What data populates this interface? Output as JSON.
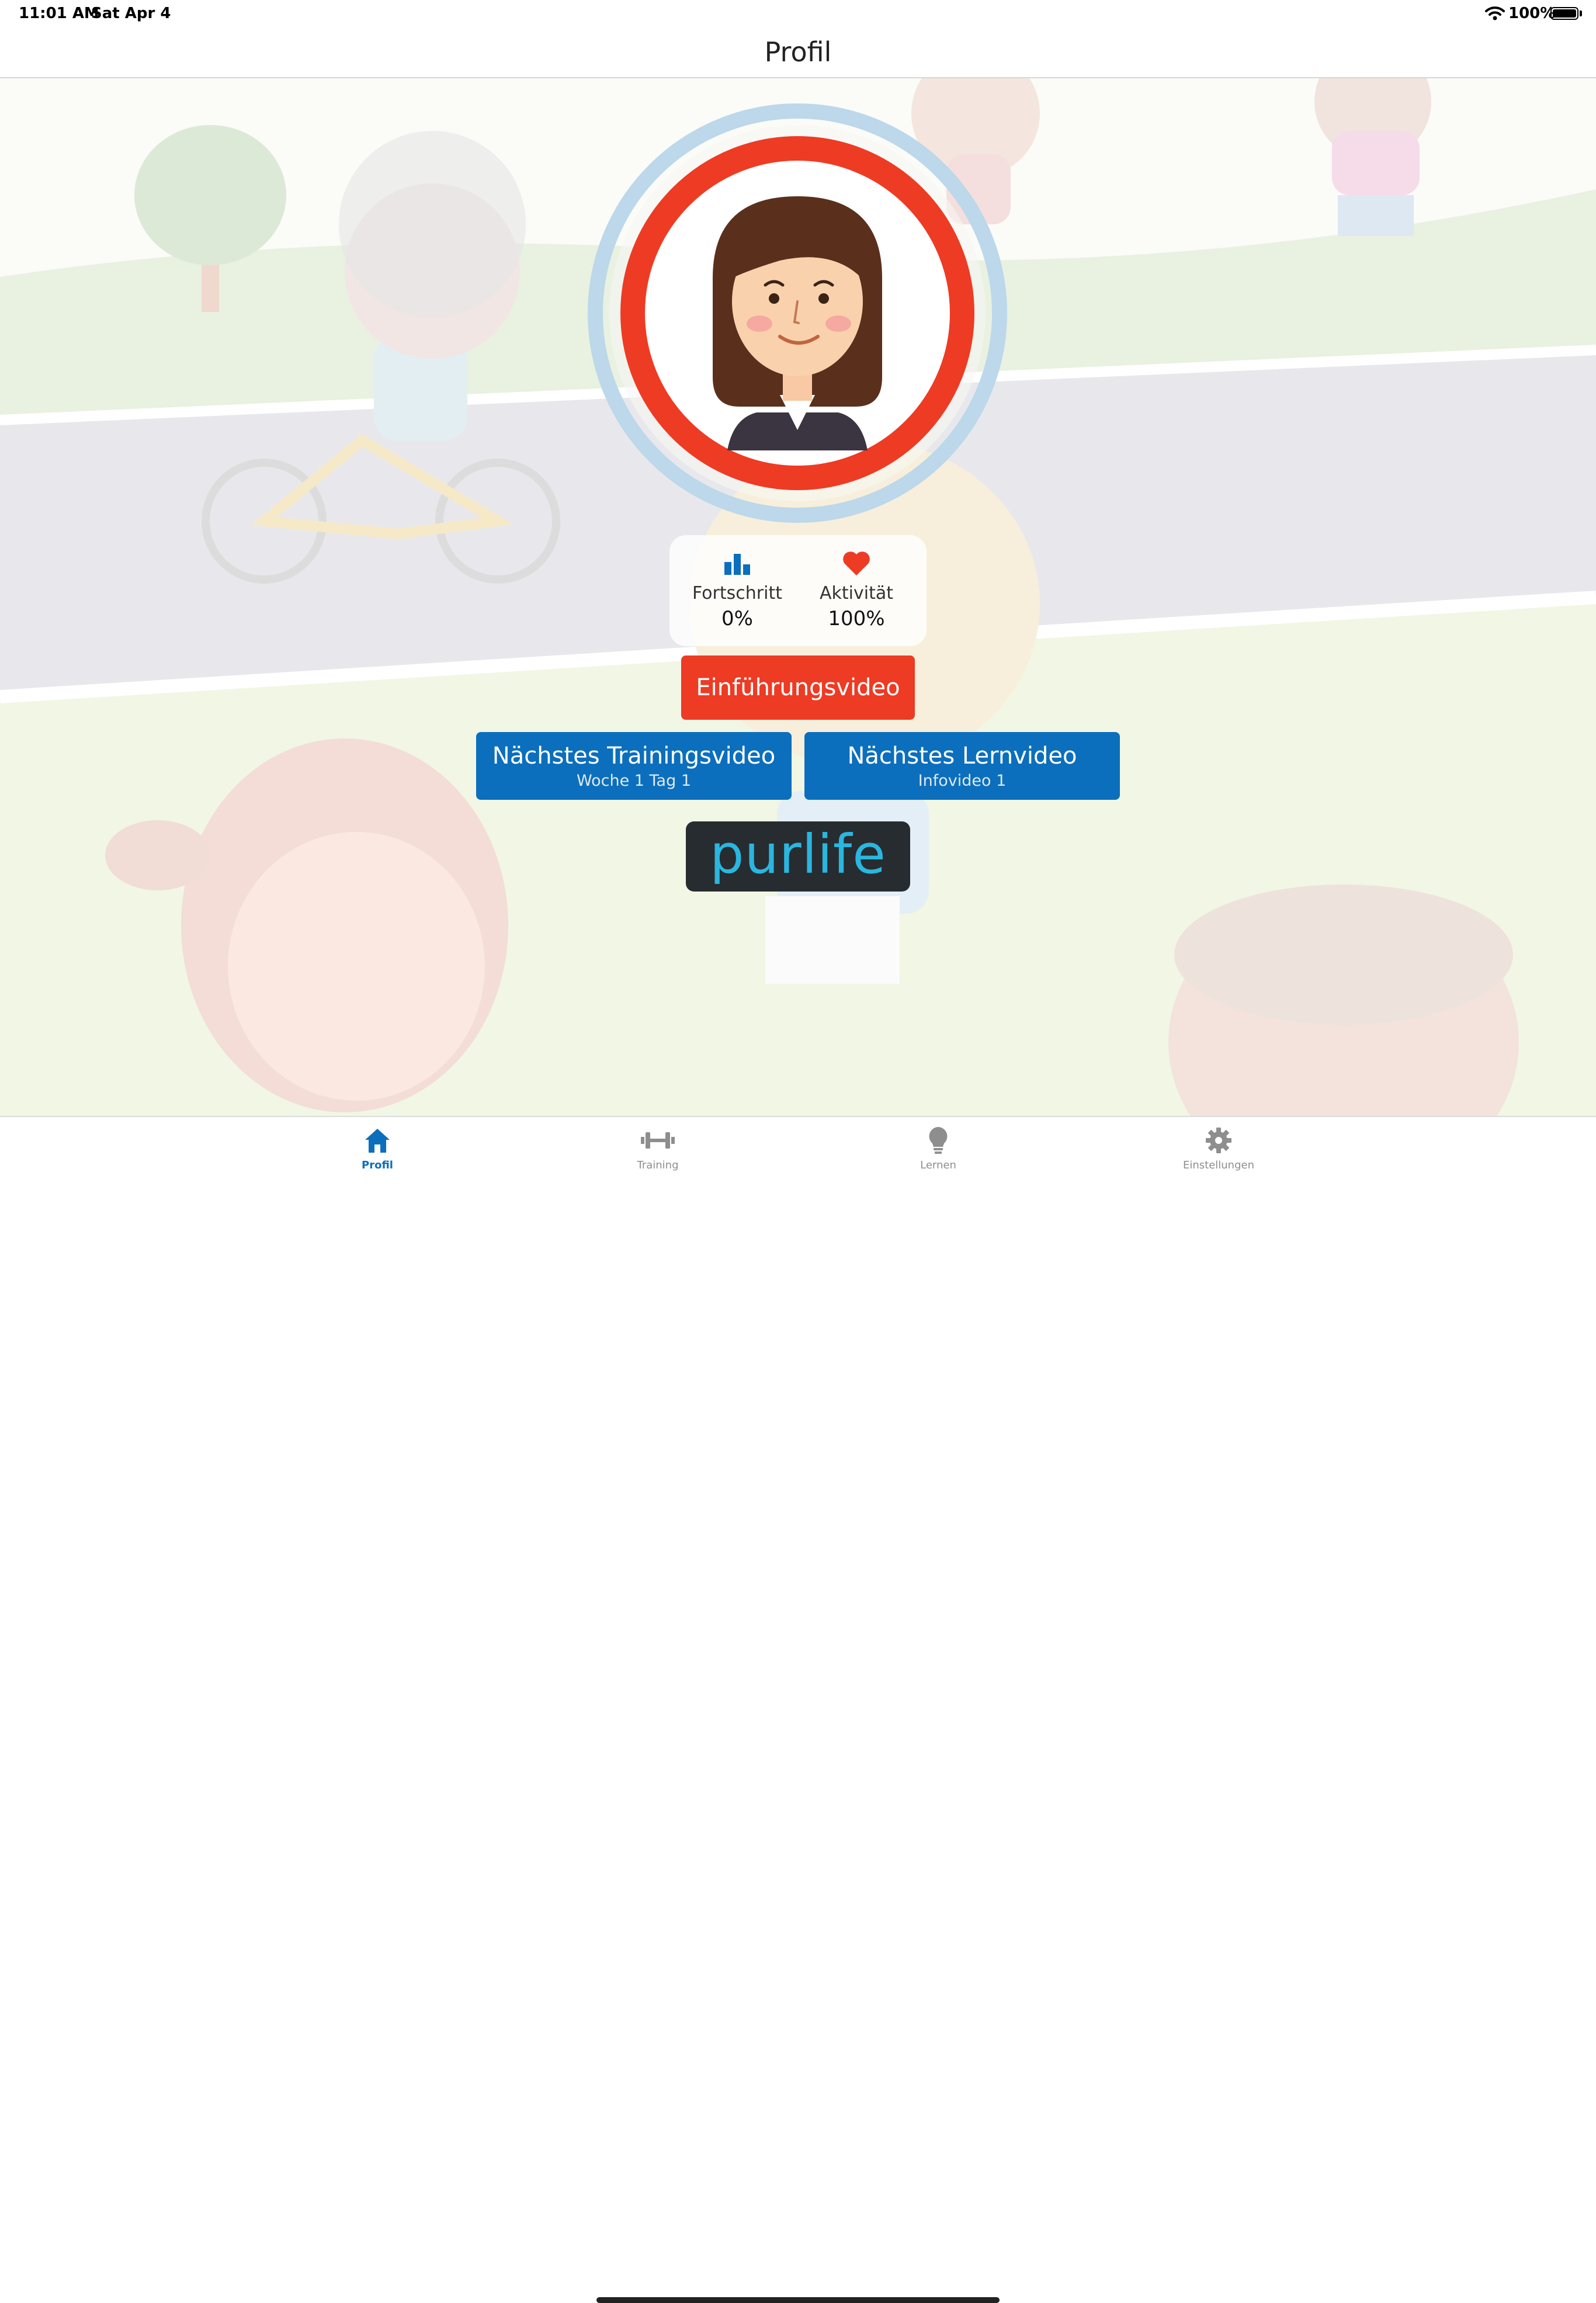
{
  "status_bar": {
    "time": "11:01 AM",
    "date": "Sat Apr 4",
    "battery": "100%"
  },
  "nav": {
    "title": "Profil"
  },
  "stats": {
    "progress": {
      "label": "Fortschritt",
      "value": "0%",
      "icon": "bar-chart-icon"
    },
    "activity": {
      "label": "Aktivität",
      "value": "100%",
      "icon": "heart-icon"
    }
  },
  "buttons": {
    "intro": "Einführungsvideo",
    "training": {
      "title": "Nächstes Trainingsvideo",
      "subtitle": "Woche 1 Tag 1"
    },
    "learn": {
      "title": "Nächstes Lernvideo",
      "subtitle": "Infovideo 1"
    }
  },
  "logo": {
    "text": "purlife"
  },
  "tabs": [
    {
      "label": "Profil",
      "icon": "home-icon",
      "active": true
    },
    {
      "label": "Training",
      "icon": "dumbbell-icon",
      "active": false
    },
    {
      "label": "Lernen",
      "icon": "lightbulb-icon",
      "active": false
    },
    {
      "label": "Einstellungen",
      "icon": "gear-icon",
      "active": false
    }
  ],
  "colors": {
    "accent_red": "#ee3b24",
    "accent_blue": "#0b6fbd",
    "ring_light_blue": "#bcd8ea",
    "logo_bg": "#272c30",
    "logo_text": "#2ab6df"
  }
}
